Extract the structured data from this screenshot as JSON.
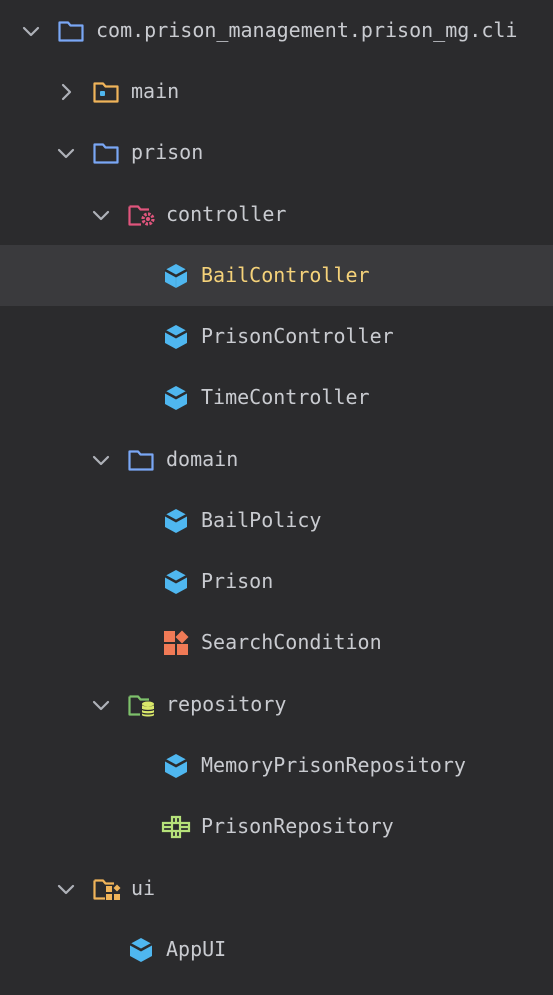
{
  "tree": {
    "root": {
      "label": "com.prison_management.prison_mg.cli",
      "icon": "package-folder-icon",
      "expanded": true
    },
    "main": {
      "label": "main",
      "icon": "module-folder-icon",
      "expanded": false
    },
    "prison": {
      "label": "prison",
      "icon": "package-folder-icon",
      "expanded": true
    },
    "controller": {
      "label": "controller",
      "icon": "controller-folder-icon",
      "expanded": true
    },
    "bail_controller": {
      "label": "BailController",
      "icon": "class-icon",
      "selected": true
    },
    "prison_controller": {
      "label": "PrisonController",
      "icon": "class-icon"
    },
    "time_controller": {
      "label": "TimeController",
      "icon": "class-icon"
    },
    "domain": {
      "label": "domain",
      "icon": "package-folder-icon",
      "expanded": true
    },
    "bail_policy": {
      "label": "BailPolicy",
      "icon": "class-icon"
    },
    "prison_class": {
      "label": "Prison",
      "icon": "class-icon"
    },
    "search_condition": {
      "label": "SearchCondition",
      "icon": "record-icon"
    },
    "repository": {
      "label": "repository",
      "icon": "repository-folder-icon",
      "expanded": true
    },
    "memory_prison_repository": {
      "label": "MemoryPrisonRepository",
      "icon": "class-icon"
    },
    "prison_repository": {
      "label": "PrisonRepository",
      "icon": "interface-icon"
    },
    "ui": {
      "label": "ui",
      "icon": "ui-folder-icon",
      "expanded": true
    },
    "app_ui": {
      "label": "AppUI",
      "icon": "class-icon"
    }
  },
  "colors": {
    "background": "#2b2b2d",
    "selected_row": "#3a3a3d",
    "text": "#c9cbd0",
    "selected_text": "#f5d27a",
    "folder_blue": "#7aa7f5",
    "folder_yellow": "#f0b45a",
    "folder_pink": "#e0557d",
    "folder_green": "#7ec16b",
    "class_blue": "#4fb7f0",
    "record_orange": "#f07a56",
    "interface_green": "#b6e27a"
  }
}
